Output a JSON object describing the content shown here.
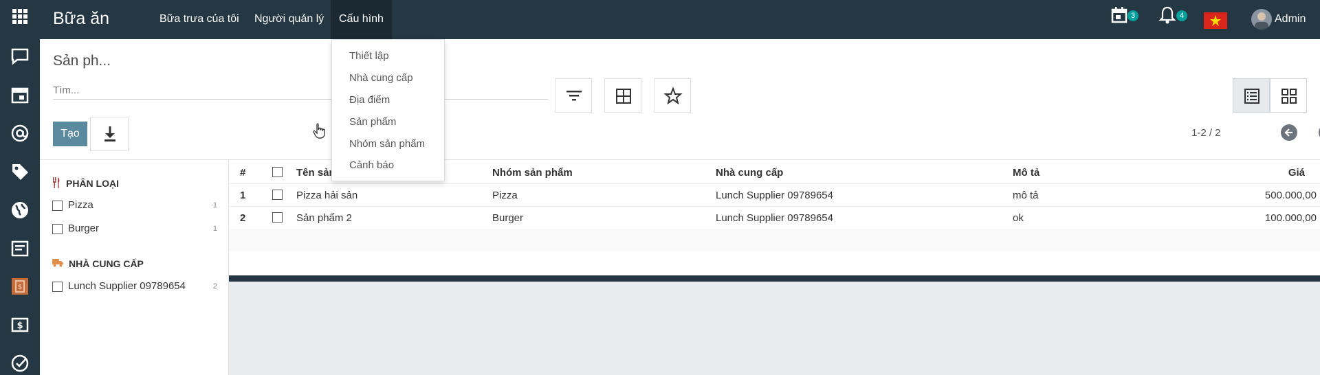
{
  "topbar": {
    "app_title": "Bữa ăn",
    "menu": [
      "Bữa trưa của tôi",
      "Người quản lý",
      "Cấu hình"
    ],
    "activities_badge": "3",
    "notifications_badge": "4",
    "user_name": "Admin"
  },
  "config_menu": {
    "items": [
      "Thiết lập",
      "Nhà cung cấp",
      "Địa điểm",
      "Sản phẩm",
      "Nhóm sản phẩm",
      "Cảnh báo"
    ]
  },
  "control_panel": {
    "breadcrumb": "Sản ph...",
    "search_placeholder": "Tìm...",
    "create_label": "Tạo",
    "pager": "1-2 / 2"
  },
  "side_panel": {
    "category_title": "PHÂN LOẠI",
    "categories": [
      {
        "label": "Pizza",
        "count": "1"
      },
      {
        "label": "Burger",
        "count": "1"
      }
    ],
    "supplier_title": "NHÀ CUNG CẤP",
    "suppliers": [
      {
        "label": "Lunch Supplier 09789654",
        "count": "2"
      }
    ]
  },
  "list": {
    "headers": {
      "num": "#",
      "name": "Tên sản",
      "category": "Nhóm sản phẩm",
      "supplier": "Nhà cung cấp",
      "description": "Mô tả",
      "price": "Giá"
    },
    "rows": [
      {
        "num": "1",
        "name": "Pizza hải sản",
        "category": "Pizza",
        "supplier": "Lunch Supplier 09789654",
        "description": "mô tả",
        "price": "500.000,00"
      },
      {
        "num": "2",
        "name": "Sản phẩm 2",
        "category": "Burger",
        "supplier": "Lunch Supplier 09789654",
        "description": "ok",
        "price": "100.000,00"
      }
    ]
  },
  "colors": {
    "topbar": "#243742",
    "primary_button": "#5b899e",
    "badge": "#00a09d"
  },
  "icons": [
    "apps-grid-icon",
    "calendar-icon",
    "bell-icon",
    "vietnam-flag-icon",
    "chat-icon",
    "at-icon",
    "tag-icon",
    "globe-icon",
    "document-icon",
    "invoice-icon",
    "money-icon",
    "check-circle-icon",
    "filter-icon",
    "group-by-icon",
    "star-icon",
    "download-icon",
    "list-view-icon",
    "kanban-view-icon",
    "arrow-left-icon",
    "arrow-right-icon",
    "utensils-icon",
    "truck-icon",
    "hand-cursor-icon"
  ]
}
